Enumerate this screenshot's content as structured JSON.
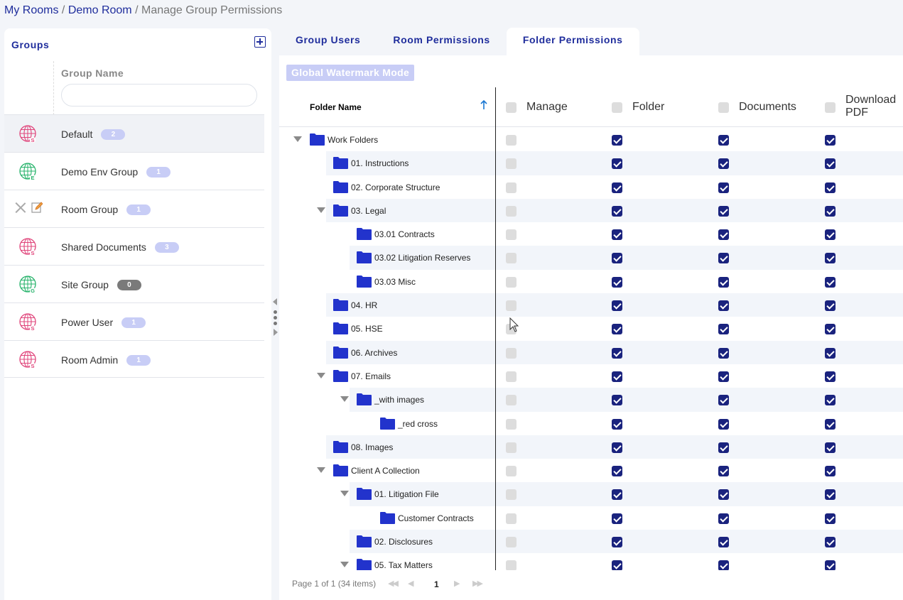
{
  "breadcrumb": {
    "items": [
      "My Rooms",
      "Demo Room"
    ],
    "separator": "/",
    "current": "Manage Group Permissions"
  },
  "groups_panel": {
    "title": "Groups",
    "column_header": "Group Name",
    "filter_value": "",
    "groups": [
      {
        "name": "Default",
        "count": "2",
        "icon": "globe-icon",
        "letter": "S",
        "color": "#e0457b",
        "selected": true
      },
      {
        "name": "Demo Env Group",
        "count": "1",
        "icon": "globe-icon",
        "letter": "E",
        "color": "#27b36b"
      },
      {
        "name": "Room Group",
        "count": "1",
        "icon": "actions",
        "letter": ""
      },
      {
        "name": "Shared Documents",
        "count": "3",
        "icon": "globe-icon",
        "letter": "S",
        "color": "#e0457b"
      },
      {
        "name": "Site Group",
        "count": "0",
        "icon": "globe-icon",
        "letter": "G",
        "color": "#27b36b",
        "badge_dark": true
      },
      {
        "name": "Power User",
        "count": "1",
        "icon": "globe-icon",
        "letter": "S",
        "color": "#e0457b"
      },
      {
        "name": "Room Admin",
        "count": "1",
        "icon": "globe-icon",
        "letter": "S",
        "color": "#e0457b"
      }
    ]
  },
  "tabs": [
    "Group Users",
    "Room Permissions",
    "Folder Permissions"
  ],
  "active_tab": 2,
  "watermark_button": "Global Watermark Mode",
  "grid": {
    "folder_col": "Folder Name",
    "columns": [
      "Manage",
      "Folder",
      "Documents",
      "Download\nPDF"
    ],
    "rows": [
      {
        "name": "Work Folders",
        "level": 0,
        "expanded": true
      },
      {
        "name": "01. Instructions",
        "level": 1
      },
      {
        "name": "02. Corporate Structure",
        "level": 1
      },
      {
        "name": "03. Legal",
        "level": 1,
        "expanded": true
      },
      {
        "name": "03.01 Contracts",
        "level": 2
      },
      {
        "name": "03.02 Litigation Reserves",
        "level": 2
      },
      {
        "name": "03.03 Misc",
        "level": 2
      },
      {
        "name": "04. HR",
        "level": 1
      },
      {
        "name": "05. HSE",
        "level": 1
      },
      {
        "name": "06. Archives",
        "level": 1
      },
      {
        "name": "07. Emails",
        "level": 1,
        "expanded": true
      },
      {
        "name": "_with images",
        "level": 2,
        "expanded": true
      },
      {
        "name": "_red cross",
        "level": 3
      },
      {
        "name": "08. Images",
        "level": 1
      },
      {
        "name": "Client A Collection",
        "level": 1,
        "expanded": true
      },
      {
        "name": "01. Litigation File",
        "level": 2,
        "expanded": true
      },
      {
        "name": "Customer Contracts",
        "level": 3
      },
      {
        "name": "02. Disclosures",
        "level": 2
      },
      {
        "name": "05. Tax Matters",
        "level": 2,
        "expanded": true
      }
    ],
    "row_permissions": {
      "manage": false,
      "folder": true,
      "documents": true,
      "download_pdf": true
    }
  },
  "pager": {
    "info": "Page 1 of 1 (34 items)",
    "current_page": "1"
  },
  "colors": {
    "brand": "#1f2d9c",
    "checkbox_on": "#1a237e",
    "folder": "#2233cc",
    "badge": "#c8cdf6"
  }
}
